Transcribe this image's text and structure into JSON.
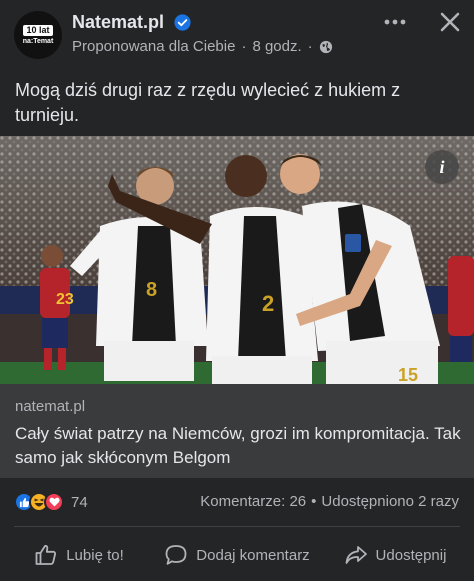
{
  "header": {
    "avatar": {
      "line1": "10 lat",
      "line2": "na:Temat"
    },
    "page_name": "Natemat.pl",
    "subtitle": "Proponowana dla Ciebie",
    "time": "8 godz.",
    "separator": "·",
    "privacy_icon": "globe-icon",
    "more_icon": "more-horizontal-icon",
    "close_icon": "close-icon"
  },
  "post": {
    "text": "Mogą dziś drugi raz z rzędu wylecieć z hukiem z turnieju."
  },
  "photo": {
    "shirt_numbers": [
      "8",
      "2",
      "15",
      "23"
    ],
    "info_label": "i"
  },
  "link_preview": {
    "domain": "natemat.pl",
    "title": "Cały świat patrzy na Niemców, grozi im kompromitacja. Tak samo jak skłóconym Belgom"
  },
  "engagement": {
    "reaction_icons": [
      "like-reaction-icon",
      "haha-reaction-icon",
      "love-reaction-icon"
    ],
    "reaction_count": "74",
    "comments": "Komentarze: 26",
    "dot": "•",
    "shares": "Udostępniono 2 razy"
  },
  "actions": {
    "like": "Lubię to!",
    "comment": "Dodaj komentarz",
    "share": "Udostępnij"
  },
  "colors": {
    "background": "#242526",
    "link_box": "#3a3b3c",
    "accent": "#1b74e4",
    "text_secondary": "#b0b3b8"
  }
}
